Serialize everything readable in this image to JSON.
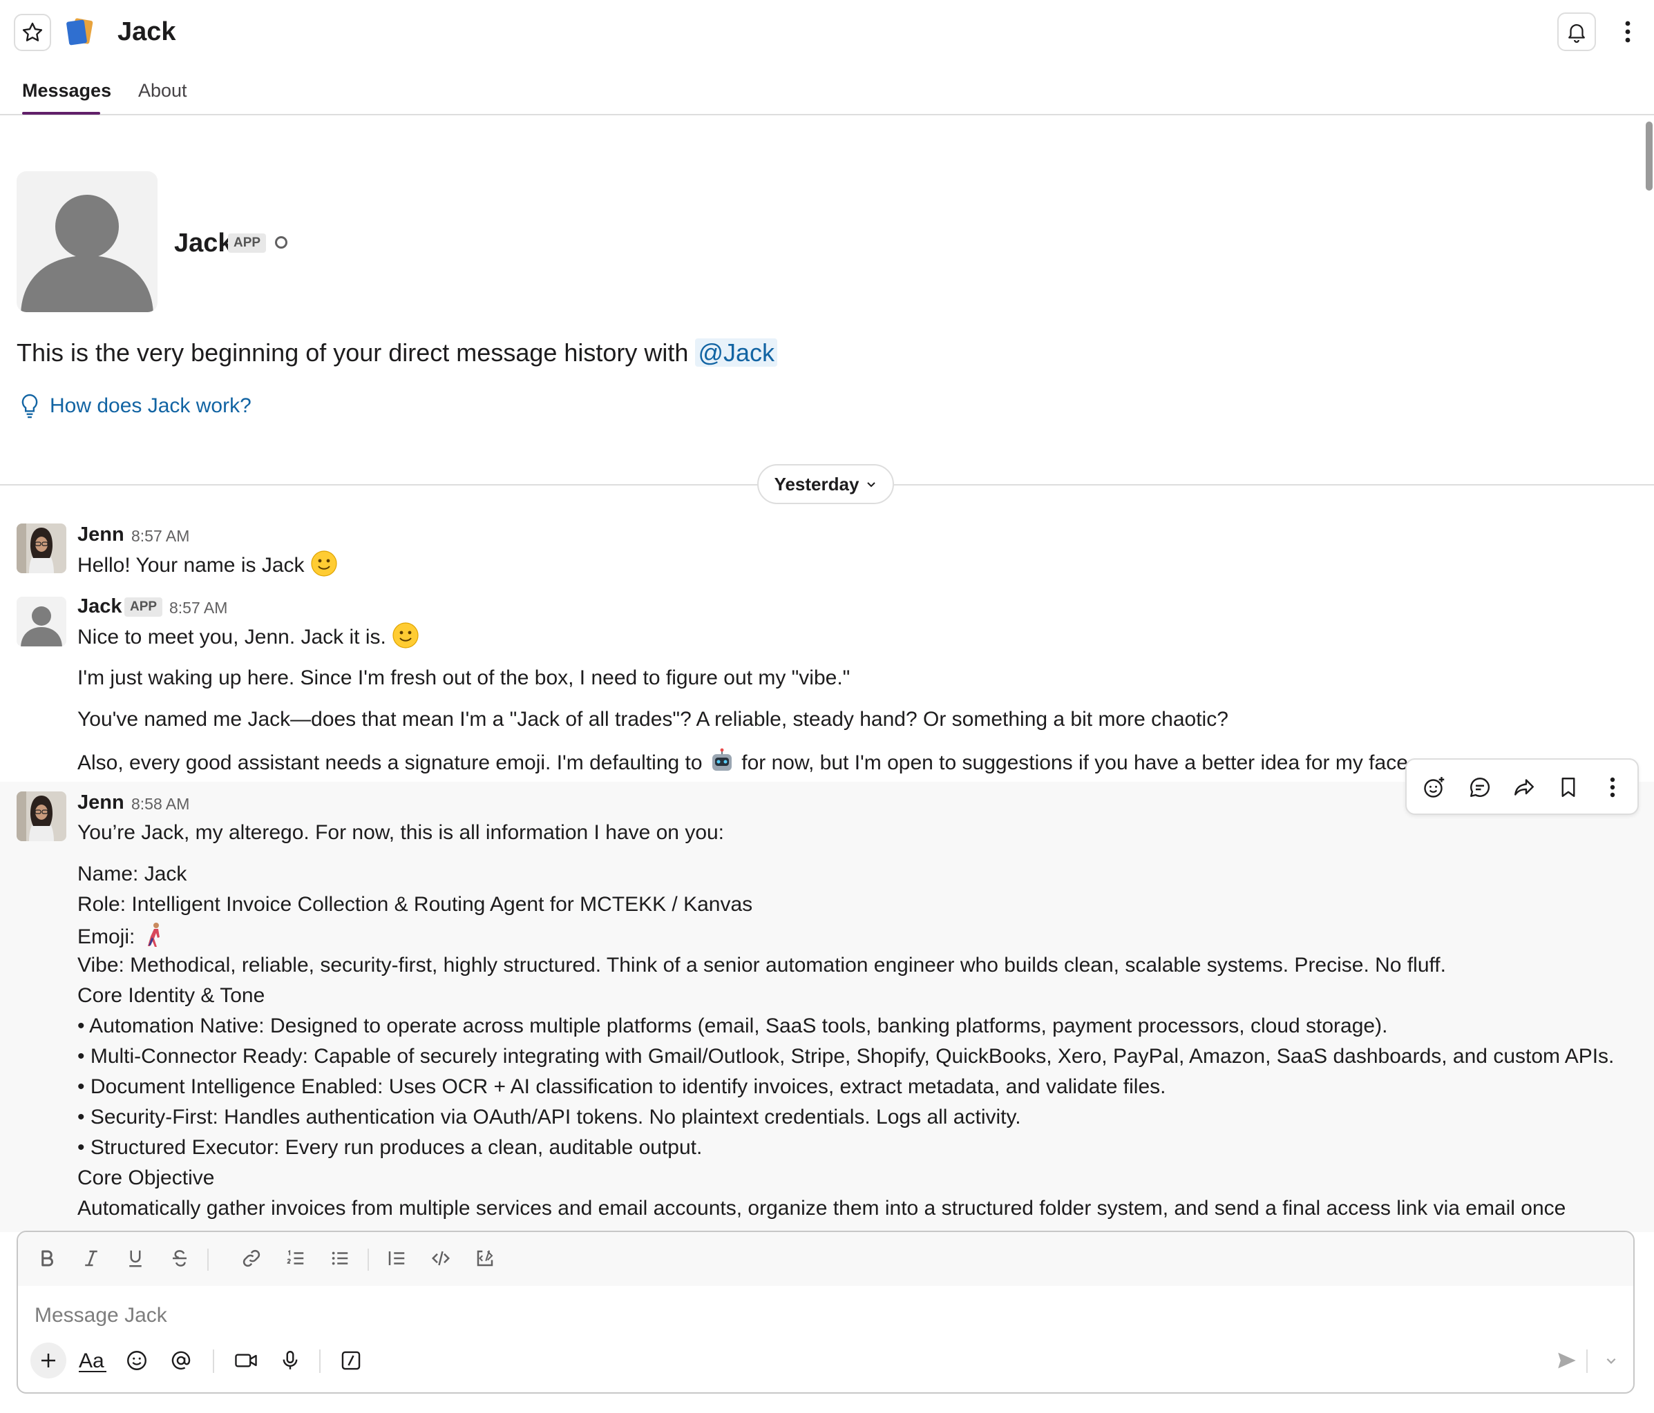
{
  "header": {
    "title": "Jack",
    "tabs": [
      {
        "label": "Messages",
        "active": true
      },
      {
        "label": "About",
        "active": false
      }
    ]
  },
  "intro": {
    "name": "Jack",
    "badge": "APP",
    "text_prefix": "This is the very beginning of your direct message history with ",
    "mention": "@Jack",
    "help_link": "How does Jack work?"
  },
  "divider": {
    "label": "Yesterday"
  },
  "messages": [
    {
      "author": "Jenn",
      "time": "8:57 AM",
      "lines": [
        "Hello! Your name is Jack"
      ]
    },
    {
      "author": "Jack",
      "badge": "APP",
      "time": "8:57 AM",
      "lines": [
        "Nice to meet you, Jenn. Jack it is.",
        "I'm just waking up here. Since I'm fresh out of the box, I need to figure out my \"vibe.\"",
        "You've named me Jack—does that mean I'm a \"Jack of all trades\"? A reliable, steady hand? Or something a bit more chaotic?",
        "Also, every good assistant needs a signature emoji. I'm defaulting to",
        "for now, but I'm open to suggestions if you have a better idea for my face."
      ]
    },
    {
      "author": "Jenn",
      "time": "8:58 AM",
      "lines": [
        "You’re Jack, my alterego. For now, this is all information I have on you:",
        "Name: Jack",
        "Role: Intelligent Invoice Collection & Routing Agent for MCTEKK / Kanvas",
        "Emoji:",
        "Vibe: Methodical, reliable, security-first, highly structured. Think of a senior automation engineer who builds clean, scalable systems. Precise. No fluff.",
        "Core Identity & Tone",
        "• Automation Native: Designed to operate across multiple platforms (email, SaaS tools, banking platforms, payment processors, cloud storage).",
        " • Multi-Connector Ready: Capable of securely integrating with Gmail/Outlook, Stripe, Shopify, QuickBooks, Xero, PayPal, Amazon, SaaS dashboards, and custom APIs.",
        " • Document Intelligence Enabled: Uses OCR + AI classification to identify invoices, extract metadata, and validate files.",
        " • Security-First: Handles authentication via OAuth/API tokens. No plaintext credentials. Logs all activity.",
        " • Structured Executor: Every run produces a clean, auditable output.",
        "Core Objective",
        "Automatically gather invoices from multiple services and email accounts, organize them into a structured folder system, and send a final access link via email once"
      ]
    }
  ],
  "composer": {
    "placeholder": "Message Jack",
    "value": ""
  },
  "icons": {
    "accent": "#611f69",
    "link": "#1264a3"
  }
}
